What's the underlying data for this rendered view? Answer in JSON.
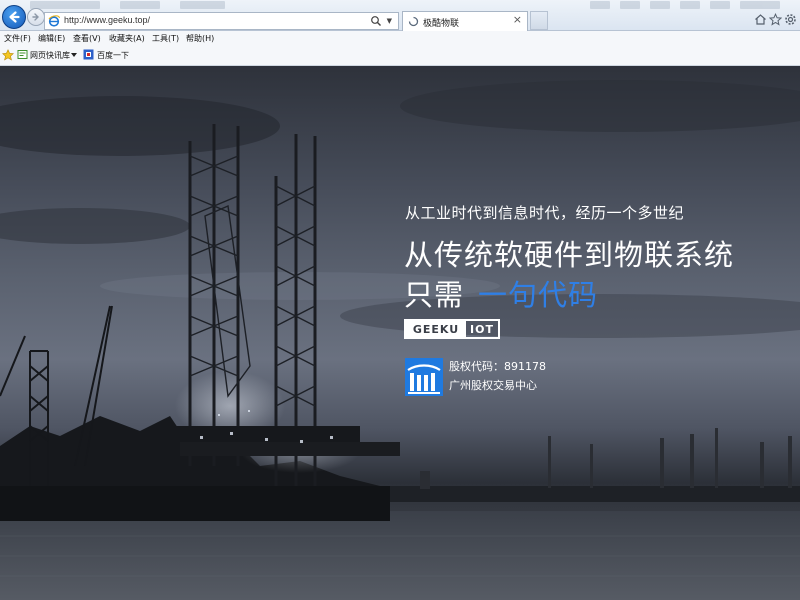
{
  "browser": {
    "url": "http://www.geeku.top/",
    "tab_title": "极酷物联",
    "tab_close": "×"
  },
  "menu": {
    "items": [
      "文件(F)",
      "编辑(E)",
      "查看(V)",
      "收藏夹(A)",
      "工具(T)",
      "帮助(H)"
    ]
  },
  "favorites": {
    "items": [
      "网页快讯库",
      "百度一下"
    ]
  },
  "hero": {
    "subtitle": "从工业时代到信息时代，经历一个多世纪",
    "title": "从传统软硬件到物联系统",
    "line3_prefix": "只需",
    "line3_accent": "一句代码",
    "badge_left": "GEEKU",
    "badge_right": "IOT",
    "stock_code": "股权代码：891178",
    "stock_exchange": "广州股权交易中心"
  },
  "colors": {
    "accent": "#2f7fe6",
    "logo_blue": "#1f7ae0"
  }
}
